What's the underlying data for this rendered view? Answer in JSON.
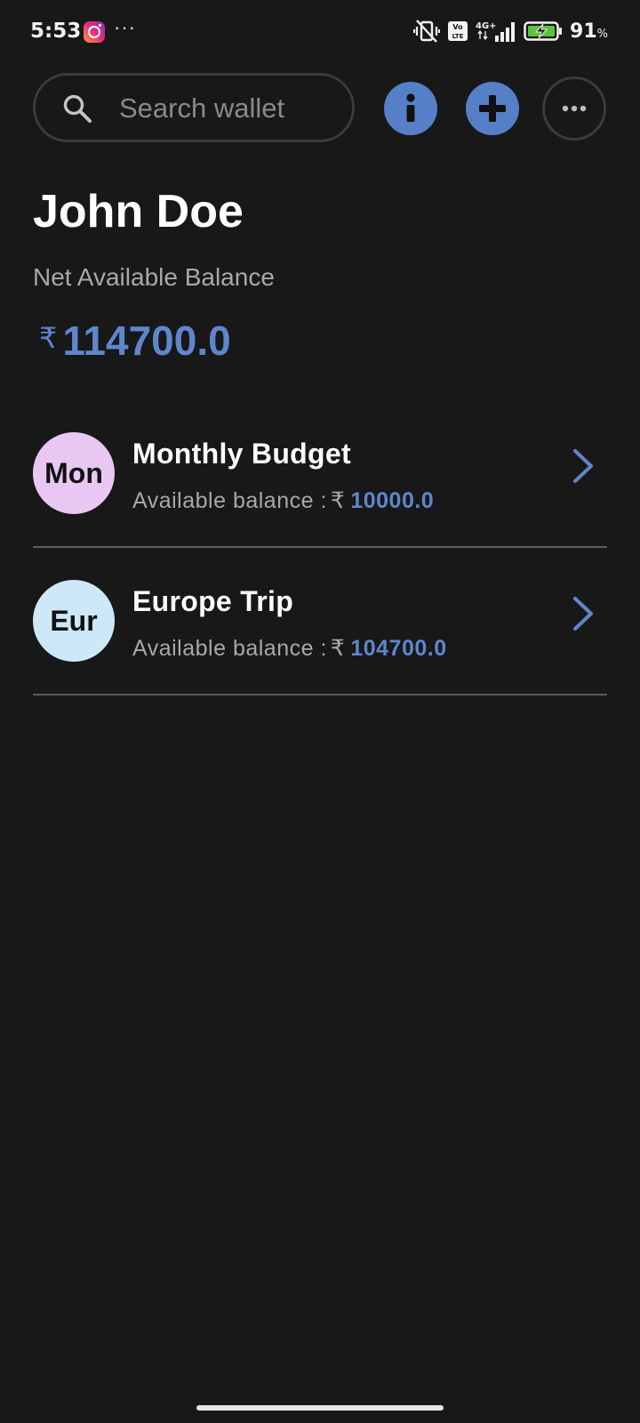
{
  "status_bar": {
    "time": "5:53",
    "more_dots": "···",
    "battery_percent": "91",
    "battery_percent_sign": "%",
    "network_label": "4G+",
    "volte_label": "Vo LTE"
  },
  "search": {
    "placeholder": "Search wallet",
    "value": ""
  },
  "header": {
    "user_name": "John Doe",
    "net_label": "Net Available Balance",
    "currency_symbol": "₹",
    "net_amount": "114700.0"
  },
  "wallets": [
    {
      "avatar_text": "Mon",
      "avatar_color": "#e8c8f2",
      "name": "Monthly Budget",
      "balance_label": "Available balance :",
      "currency_symbol": "₹",
      "amount": "10000.0"
    },
    {
      "avatar_text": "Eur",
      "avatar_color": "#cde8f6",
      "name": "Europe Trip",
      "balance_label": "Available balance :",
      "currency_symbol": "₹",
      "amount": "104700.0"
    }
  ],
  "colors": {
    "background": "#181818",
    "accent": "#5580c8",
    "amount_text": "#5e86cc",
    "secondary_text": "#a8a8a8",
    "divider": "#5a5a5a"
  },
  "icons": {
    "search": "search-icon",
    "info": "info-icon",
    "add": "plus-icon",
    "more": "more-horizontal-icon",
    "chevron": "chevron-right-icon"
  }
}
